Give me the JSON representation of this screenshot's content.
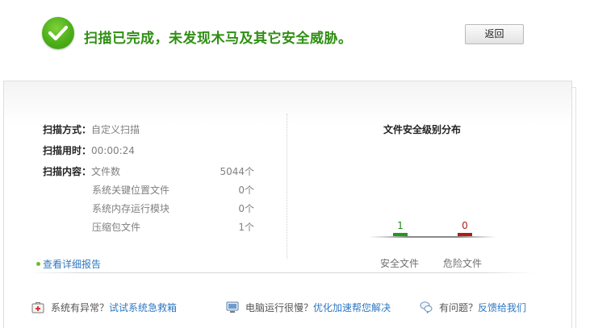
{
  "header": {
    "title": "扫描已完成，未发现木马及其它安全威胁。",
    "back_button": "返回"
  },
  "scan_info": {
    "method_label": "扫描方式：",
    "method_value": "自定义扫描",
    "time_label": "扫描用时：",
    "time_value": "00:00:24",
    "content_label": "扫描内容：",
    "items": [
      {
        "name": "文件数",
        "count": "5044个"
      },
      {
        "name": "系统关键位置文件",
        "count": "0个"
      },
      {
        "name": "系统内存运行模块",
        "count": "0个"
      },
      {
        "name": "压缩包文件",
        "count": "1个"
      }
    ],
    "detail_link": "查看详细报告"
  },
  "chart_data": {
    "type": "bar",
    "title": "文件安全级别分布",
    "categories": [
      "安全文件",
      "危险文件"
    ],
    "values": [
      1,
      0
    ],
    "value_labels": [
      "1",
      "0"
    ],
    "colors": [
      "#1d9a1d",
      "#b11b1b"
    ]
  },
  "footer": {
    "items": [
      {
        "icon": "first-aid-kit-icon",
        "text": "系统有异常？",
        "link": "试试系统急救箱"
      },
      {
        "icon": "monitor-icon",
        "text": "电脑运行很慢？",
        "link": "优化加速帮您解决"
      },
      {
        "icon": "chat-bubbles-icon",
        "text": "有问题？",
        "link": "反馈给我们"
      }
    ]
  }
}
